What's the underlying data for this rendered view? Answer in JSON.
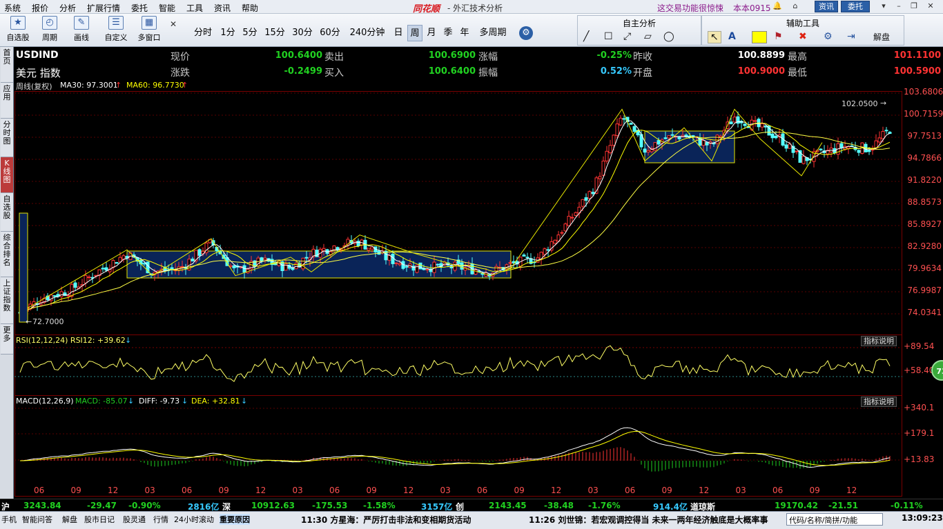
{
  "menubar": {
    "items": [
      "系统",
      "报价",
      "分析",
      "扩展行情",
      "委托",
      "智能",
      "工具",
      "资讯",
      "帮助"
    ],
    "logo": "同花顺",
    "title": "- 外汇技术分析",
    "promo": "这交易功能很惊悚",
    "version": "本本0915",
    "btn_news": "资讯",
    "btn_trade": "委托"
  },
  "toolbar": {
    "buttons": [
      "自选股",
      "周期",
      "画线",
      "自定义",
      "多窗口"
    ],
    "periods": [
      "分时",
      "1分",
      "5分",
      "15分",
      "30分",
      "60分",
      "240分钟",
      "日",
      "周",
      "月",
      "季",
      "年",
      "多周期"
    ],
    "active_period": "周",
    "panel_self_title": "自主分析",
    "panel_aux_title": "辅助工具",
    "aux_solve": "解盘"
  },
  "lefttabs": [
    "首页",
    "应用",
    "分时图",
    "K线图",
    "自选股",
    "综合排名",
    "上证指数",
    "更多"
  ],
  "quote": {
    "code": "USDIND",
    "name": "美元 指数",
    "labels": {
      "price": "现价",
      "change": "涨跌",
      "sell": "卖出",
      "buy": "买入",
      "pct": "涨幅",
      "amp": "振幅",
      "prevclose": "昨收",
      "open": "开盘",
      "high": "最高",
      "low": "最低"
    },
    "price": "100.6400",
    "change": "-0.2499",
    "sell": "100.6900",
    "buy": "100.6400",
    "pct": "-0.25%",
    "amp": "0.52%",
    "prevclose": "100.8899",
    "open": "100.9000",
    "high": "101.1100",
    "low": "100.5900"
  },
  "main_chart": {
    "title": "周线(复权)",
    "ma30": "MA30: 97.3001",
    "ma60": "MA60: 96.7730",
    "y_ticks": [
      "103.6806",
      "100.7159",
      "97.7513",
      "94.7866",
      "91.8220",
      "88.8573",
      "85.8927",
      "82.9280",
      "79.9634",
      "76.9987",
      "74.0341"
    ],
    "max_label": "102.0500",
    "min_label": "72.7000"
  },
  "rsi": {
    "label": "RSI(12,12,24) RSI12: +39.62",
    "explain": "指标说明",
    "y_ticks": [
      "+89.54",
      "+58.40"
    ],
    "badge": "73"
  },
  "macd": {
    "label": "MACD(12,26,9)",
    "macd": "MACD: -85.07",
    "diff": "DIFF: -9.73",
    "dea": "DEA: +32.81",
    "explain": "指标说明",
    "y_ticks": [
      "+340.1",
      "+179.1",
      "+13.83"
    ]
  },
  "x_ticks": [
    "06",
    "09",
    "12",
    "03",
    "06",
    "09",
    "12",
    "03",
    "06",
    "09",
    "12",
    "03",
    "06",
    "09",
    "12",
    "03",
    "06",
    "09",
    "12",
    "03",
    "06",
    "09",
    "12"
  ],
  "ticker": {
    "sh_label": "沪",
    "sh_value": "3243.84",
    "sh_change": "-29.47",
    "sh_pct": "-0.90%",
    "sh_amount": "2816亿",
    "sz_label": "深",
    "sz_value": "10912.63",
    "sz_change": "-175.53",
    "sz_pct": "-1.58%",
    "sz_amount": "3157亿",
    "cy_label": "创",
    "cy_value": "2143.45",
    "cy_change": "-38.48",
    "cy_pct": "-1.76%",
    "cy_amount": "914.4亿",
    "dj_label": "道琼斯",
    "dj_value": "19170.42",
    "dj_change": "-21.51",
    "dj_pct": "-0.11%"
  },
  "statusbar": {
    "items": [
      "手机",
      "智能问答",
      "解盘",
      "股市日记",
      "股灵通",
      "行情",
      "24小时滚动",
      "重要原因"
    ],
    "news1": "11:30 方星海：严厉打击非法和变相期货活动",
    "news2": "11:26 刘世锦：若宏观调控得当 未来一两年经济触底是大概率事",
    "search_placeholder": "代码/名称/简拼/功能",
    "clock": "13:09:23"
  },
  "colors": {
    "up": "#ff3333",
    "down": "#21d121",
    "ma30": "#ffffff",
    "ma60": "#ffff00",
    "box_fill": "#0a2458",
    "box_border": "#e6e600"
  }
}
